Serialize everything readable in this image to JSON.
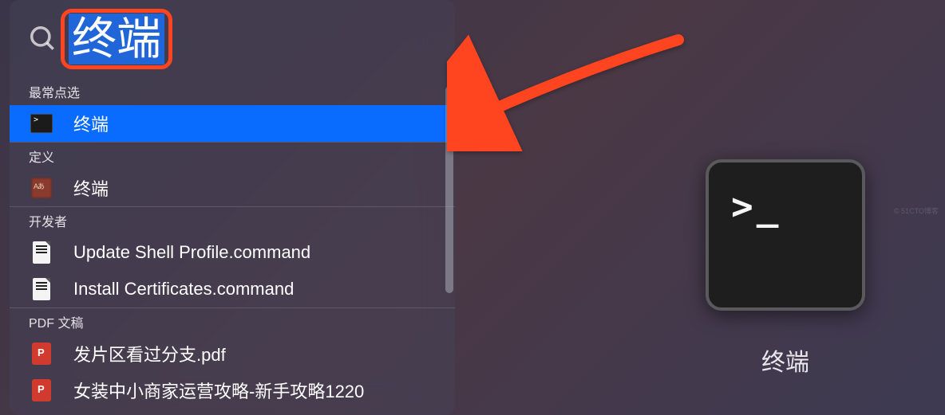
{
  "search": {
    "query": "终端"
  },
  "sections": [
    {
      "label": "最常点选",
      "items": [
        {
          "icon": "terminal",
          "label": "终端",
          "selected": true
        }
      ]
    },
    {
      "label": "定义",
      "items": [
        {
          "icon": "dictionary",
          "label": "终端",
          "selected": false
        }
      ]
    },
    {
      "label": "开发者",
      "items": [
        {
          "icon": "command-doc",
          "label": "Update Shell Profile.command",
          "selected": false
        },
        {
          "icon": "command-doc",
          "label": "Install Certificates.command",
          "selected": false
        }
      ]
    },
    {
      "label": "PDF 文稿",
      "items": [
        {
          "icon": "pdf",
          "label": "发片区看过分支.pdf",
          "selected": false
        },
        {
          "icon": "pdf",
          "label": "女装中小商家运营攻略-新手攻略1220",
          "selected": false
        }
      ]
    }
  ],
  "preview": {
    "app_name": "终端"
  },
  "colors": {
    "highlight_border": "#ff4520",
    "selected_bg": "#0a6bff",
    "arrow": "#ff4520"
  },
  "watermark": "© 51CTO博客"
}
